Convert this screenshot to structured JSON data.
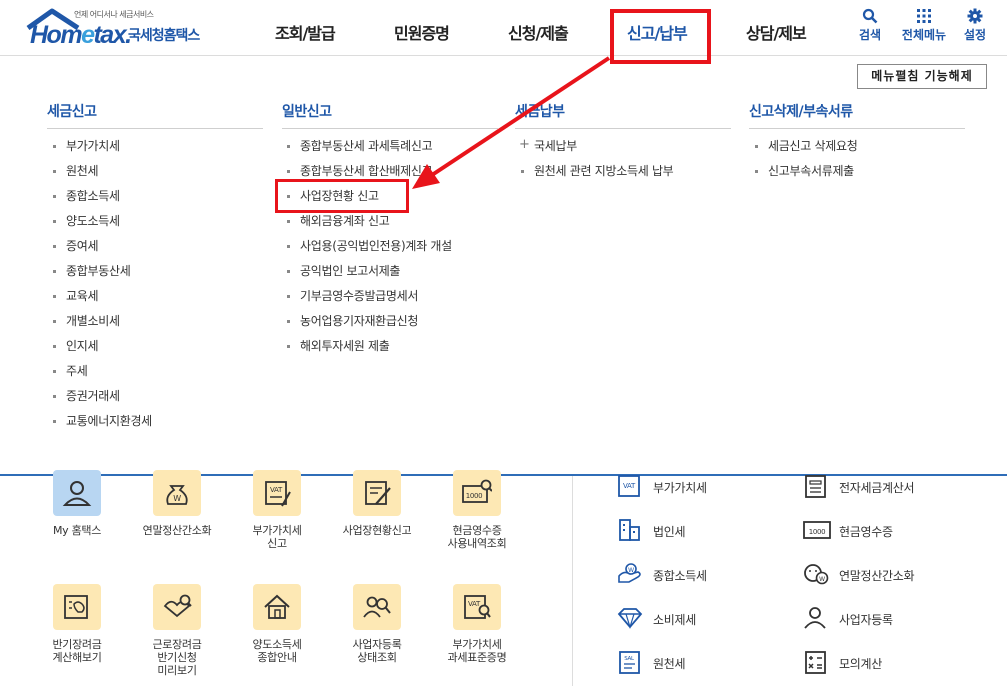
{
  "header": {
    "logo_tag": "언제 어디서나 세금서비스",
    "logo_word_a": "Hom",
    "logo_word_e": "e",
    "logo_word_b": "tax.",
    "logo_sub": "국세청홈택스",
    "gnb": [
      "조회/발급",
      "민원증명",
      "신청/제출",
      "신고/납부",
      "상담/제보"
    ],
    "util": {
      "search": "검색",
      "all_menu": "전체메뉴",
      "settings": "설정"
    },
    "fold_button": "메뉴펼침 기능해제"
  },
  "mega_menu": {
    "columns": [
      {
        "title": "세금신고",
        "items": [
          "부가가치세",
          "원천세",
          "종합소득세",
          "양도소득세",
          "증여세",
          "종합부동산세",
          "교육세",
          "개별소비세",
          "인지세",
          "주세",
          "증권거래세",
          "교통에너지환경세"
        ]
      },
      {
        "title": "일반신고",
        "items": [
          "종합부동산세 과세특례신고",
          "종합부동산세 합산배제신고",
          "사업장현황 신고",
          "해외금융계좌 신고",
          "사업용(공익법인전용)계좌 개설",
          "공익법인 보고서제출",
          "기부금영수증발급명세서",
          "농어업용기자재환급신청",
          "해외투자세원 제출"
        ]
      },
      {
        "title": "세금납부",
        "items": [
          "국세납부",
          "원천세 관련 지방소득세 납부"
        ]
      },
      {
        "title": "신고삭제/부속서류",
        "items": [
          "세금신고 삭제요청",
          "신고부속서류제출"
        ]
      }
    ]
  },
  "quick_menu": {
    "row1": [
      {
        "label1": "My 홈택스",
        "label2": ""
      },
      {
        "label1": "연말정산간소화",
        "label2": ""
      },
      {
        "label1": "부가가치세",
        "label2": "신고"
      },
      {
        "label1": "사업장현황신고",
        "label2": ""
      },
      {
        "label1": "현금영수증",
        "label2": "사용내역조회"
      }
    ],
    "row2": [
      {
        "label1": "반기장려금",
        "label2": "계산해보기",
        "label3": ""
      },
      {
        "label1": "근로장려금",
        "label2": "반기신청",
        "label3": "미리보기"
      },
      {
        "label1": "양도소득세",
        "label2": "종합안내",
        "label3": ""
      },
      {
        "label1": "사업자등록",
        "label2": "상태조회",
        "label3": ""
      },
      {
        "label1": "부가가치세",
        "label2": "과세표준증명",
        "label3": ""
      }
    ]
  },
  "right_links": {
    "left": [
      "부가가치세",
      "법인세",
      "종합소득세",
      "소비제세",
      "원천세"
    ],
    "right": [
      "전자세금계산서",
      "현금영수증",
      "연말정산간소화",
      "사업자등록",
      "모의계산"
    ]
  },
  "colors": {
    "brand_blue": "#1f57a8",
    "highlight_red": "#e8141b"
  }
}
